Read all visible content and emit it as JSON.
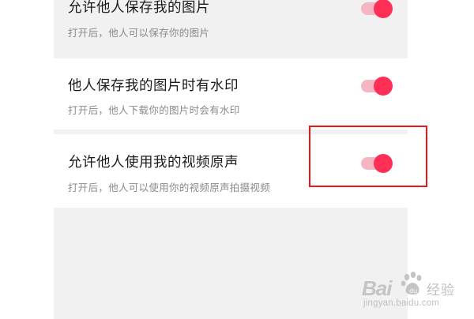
{
  "settings": {
    "items": [
      {
        "title": "允许他人保存我的图片",
        "subtitle": "打开后，他人可以保存你的图片",
        "enabled": true
      },
      {
        "title": "他人保存我的图片时有水印",
        "subtitle": "打开后，他人下载你的图片时会有水印",
        "enabled": true
      },
      {
        "title": "允许他人使用我的视频原声",
        "subtitle": "打开后，他人可以使用你的视频原声拍摄视频",
        "enabled": true
      }
    ]
  },
  "colors": {
    "toggle_on_knob": "#ff2f56",
    "toggle_on_track": "#f5b5c2",
    "highlight_border": "#e81818",
    "panel_background": "#f1f1f1"
  },
  "watermark": {
    "brand": "Bai",
    "brand_icon": "paw-icon",
    "product": "经验",
    "url": "jingyan.baidu.com"
  }
}
